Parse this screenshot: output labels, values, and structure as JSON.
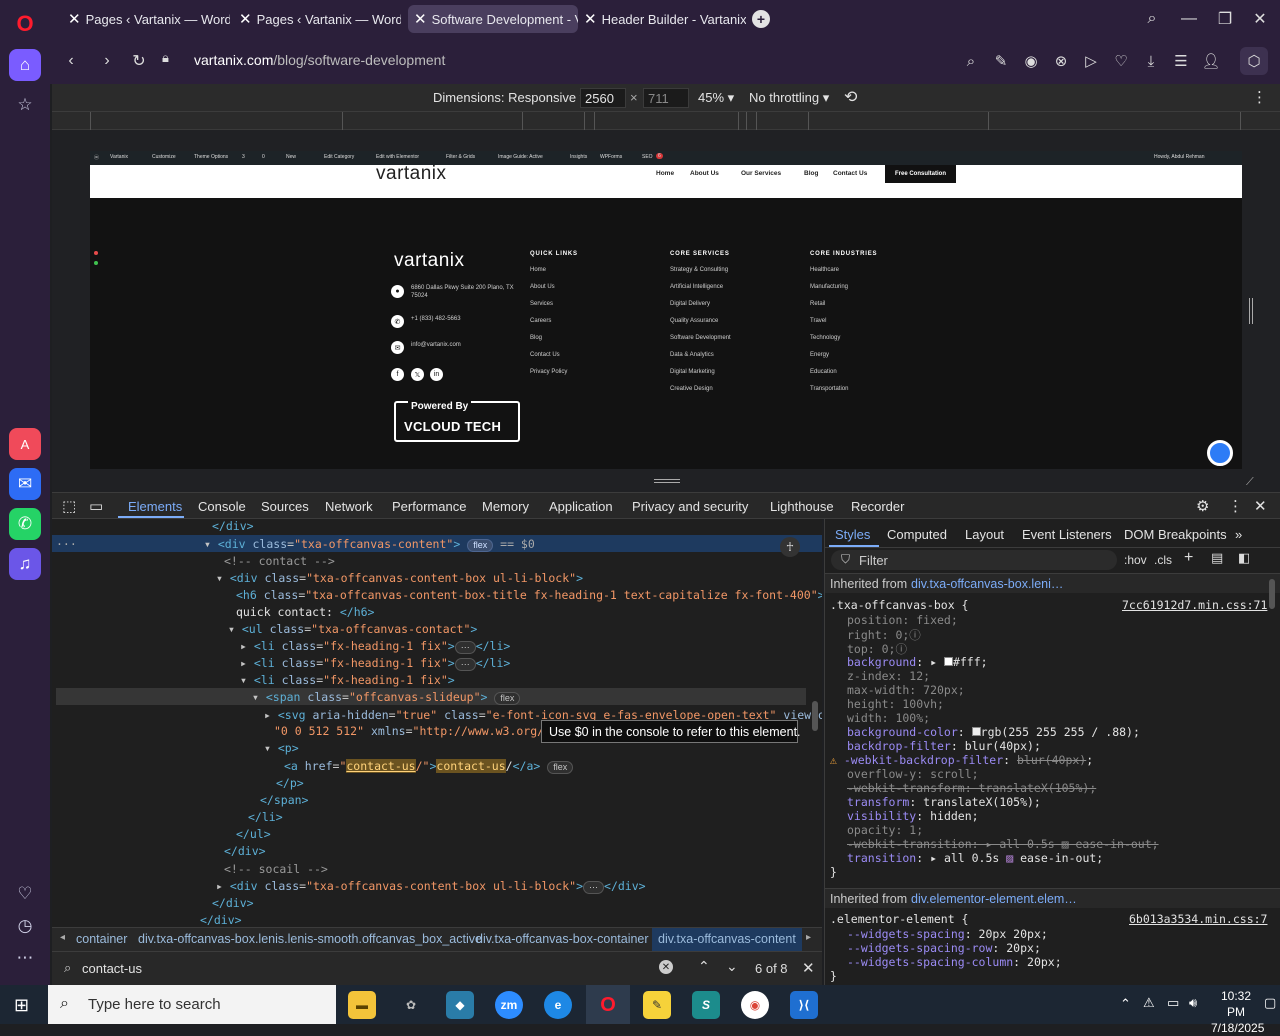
{
  "browser": {
    "tabs": [
      {
        "title": "Pages ‹ Vartanix — WordP"
      },
      {
        "title": "Pages ‹ Vartanix — WordP"
      },
      {
        "title": "Software Development - V"
      },
      {
        "title": "Header Builder - Vartanix"
      }
    ],
    "url_domain": "vartanix.com",
    "url_path": "/blog/software-development"
  },
  "device_toolbar": {
    "dimensions_label": "Dimensions: Responsive",
    "width": "2560",
    "height": "711",
    "zoom": "45%",
    "throttling": "No throttling"
  },
  "site": {
    "wpbar": [
      "Vartanix",
      "Customize",
      "Theme Options",
      "3",
      "0",
      "New",
      "Edit Category",
      "Edit with Elementor",
      "Filter & Grids",
      "Image Guide: Active",
      "Insights",
      "WPForms",
      "SEO",
      "6",
      "Howdy, Abdul Rehman"
    ],
    "logo": "vartanix",
    "nav": [
      "Home",
      "About Us",
      "Our Services",
      "Blog",
      "Contact Us"
    ],
    "cta": "Free Consultation",
    "footer": {
      "address": "6860 Dallas Pkwy Suite 200 Plano, TX 75024",
      "phone": "+1 (833) 482-5663",
      "email": "info@vartanix.com",
      "powered_by": "Powered By",
      "powered_brand": "VCLOUD TECH",
      "columns": [
        {
          "heading": "QUICK LINKS",
          "links": [
            "Home",
            "About Us",
            "Services",
            "Careers",
            "Blog",
            "Contact Us",
            "Privacy Policy"
          ]
        },
        {
          "heading": "CORE SERVICES",
          "links": [
            "Strategy & Consulting",
            "Artificial Intelligence",
            "Digital Delivery",
            "Quality Assurance",
            "Software Development",
            "Data & Analytics",
            "Digital Marketing",
            "Creative Design"
          ]
        },
        {
          "heading": "CORE INDUSTRIES",
          "links": [
            "Healthcare",
            "Manufacturing",
            "Retail",
            "Travel",
            "Technology",
            "Energy",
            "Education",
            "Transportation"
          ]
        }
      ]
    }
  },
  "devtools": {
    "tabs": [
      "Elements",
      "Console",
      "Sources",
      "Network",
      "Performance",
      "Memory",
      "Application",
      "Privacy and security",
      "Lighthouse",
      "Recorder"
    ],
    "tooltip": "Use $0 in the console to refer to this element.",
    "breadcrumbs": [
      "container",
      "div.txa-offcanvas-box.lenis.lenis-smooth.offcanvas_box_active",
      "div.txa-offcanvas-box-container",
      "div.txa-offcanvas-content"
    ],
    "search_value": "contact-us",
    "search_count": "6 of 8",
    "styles_tabs": [
      "Styles",
      "Computed",
      "Layout",
      "Event Listeners",
      "DOM Breakpoints"
    ],
    "filter_placeholder": "Filter",
    "hov": ":hov",
    "cls": ".cls",
    "inherited1_label": "Inherited from",
    "inherited1_link": "div.txa-offcanvas-box.leni…",
    "rule1_selector": ".txa-offcanvas-box {",
    "rule1_source": "7cc61912d7.min.css:71",
    "inherited2_label": "Inherited from",
    "inherited2_link": "div.elementor-element.elem…",
    "rule2_selector": ".elementor-element {",
    "rule2_source": "6b013a3534.min.css:7"
  },
  "taskbar": {
    "search_placeholder": "Type here to search",
    "time": "10:32 PM",
    "date": "7/18/2025"
  },
  "colors": {
    "accent": "#7cacf8",
    "opera_red": "#ff1b2d",
    "devtools_bg": "#1f1f1f"
  }
}
